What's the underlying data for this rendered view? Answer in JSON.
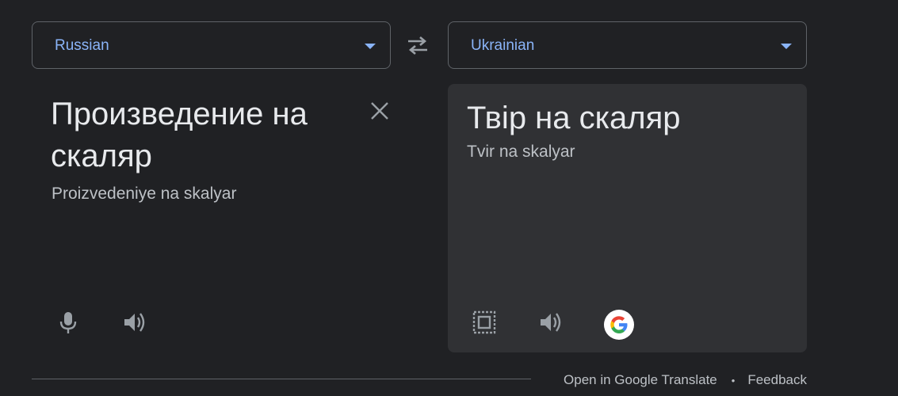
{
  "source": {
    "language": "Russian",
    "text": "Произведение на скаляр",
    "transliteration": "Proizvedeniye na skalyar"
  },
  "target": {
    "language": "Ukrainian",
    "text": "Твір на скаляр",
    "transliteration": "Tvir na skalyar"
  },
  "footer": {
    "open_link": "Open in Google Translate",
    "separator": "•",
    "feedback_link": "Feedback"
  },
  "icons": {
    "swap": "swap-arrows-icon",
    "clear": "close-icon",
    "mic": "microphone-icon",
    "speaker": "speaker-icon",
    "select": "select-text-icon",
    "google": "google-logo-icon"
  },
  "colors": {
    "background": "#202124",
    "panel": "#303134",
    "accent": "#8ab4f8",
    "text_primary": "#e8eaed",
    "text_secondary": "#bdc1c6",
    "icon": "#9aa0a6"
  }
}
